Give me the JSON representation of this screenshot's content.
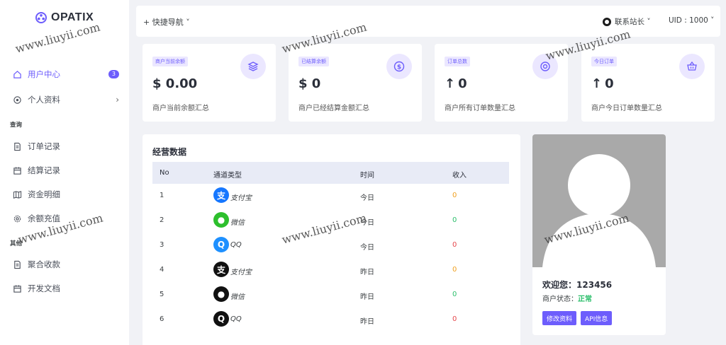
{
  "brand": {
    "name": "OPATIX"
  },
  "sidebar": {
    "items": [
      {
        "label": "用户中心",
        "badge": "3",
        "icon": "home-icon",
        "active": true
      },
      {
        "label": "个人资料",
        "icon": "user-settings-icon",
        "chevron": "›"
      }
    ],
    "sections": [
      {
        "title": "查询",
        "items": [
          {
            "label": "订单记录",
            "icon": "document-icon"
          },
          {
            "label": "结算记录",
            "icon": "calendar-icon"
          },
          {
            "label": "资金明细",
            "icon": "map-icon"
          },
          {
            "label": "余额充值",
            "icon": "cog-icon"
          }
        ]
      },
      {
        "title": "其他",
        "items": [
          {
            "label": "聚合收款",
            "icon": "document-icon"
          },
          {
            "label": "开发文档",
            "icon": "calendar-icon"
          }
        ]
      }
    ]
  },
  "topbar": {
    "quicknav_label": "+ 快捷导航 ˅",
    "contact_label": "联系站长 ˅",
    "uid_label": "UID : 1000 ˅"
  },
  "stats": [
    {
      "tag": "商户当前余额",
      "value": "$ 0.00",
      "desc": "商户当前余额汇总",
      "icon": "layers-icon"
    },
    {
      "tag": "已结算余额",
      "value": "$ 0",
      "desc": "商户已经结算金额汇总",
      "icon": "dollar-circle-icon"
    },
    {
      "tag": "订单总数",
      "value": "0",
      "desc": "商户所有订单数量汇总",
      "icon": "target-icon",
      "arrow": "↑"
    },
    {
      "tag": "今日订单",
      "value": "0",
      "desc": "商户今日订单数量汇总",
      "icon": "basket-icon",
      "arrow": "↑"
    }
  ],
  "table": {
    "title": "经营数据",
    "headers": [
      "No",
      "通道类型",
      "时间",
      "收入"
    ],
    "rows": [
      {
        "no": "1",
        "channel": "支付宝",
        "channel_icon": "alipay-icon",
        "glyph": "支",
        "time": "今日",
        "income": "0",
        "icon_color": "#1677ff",
        "income_color": "orange"
      },
      {
        "no": "2",
        "channel": "微信",
        "channel_icon": "wechat-icon",
        "glyph": "●",
        "time": "今日",
        "income": "0",
        "icon_color": "#2dbf2d",
        "income_color": "green"
      },
      {
        "no": "3",
        "channel": "QQ",
        "channel_icon": "qq-icon",
        "glyph": "Q",
        "time": "今日",
        "income": "0",
        "icon_color": "#1e90ff",
        "income_color": "red"
      },
      {
        "no": "4",
        "channel": "支付宝",
        "channel_icon": "alipay-icon",
        "glyph": "支",
        "time": "昨日",
        "income": "0",
        "icon_color": "#111111",
        "income_color": "orange"
      },
      {
        "no": "5",
        "channel": "微信",
        "channel_icon": "wechat-icon",
        "glyph": "●",
        "time": "昨日",
        "income": "0",
        "icon_color": "#111111",
        "income_color": "green"
      },
      {
        "no": "6",
        "channel": "QQ",
        "channel_icon": "qq-icon",
        "glyph": "Q",
        "time": "昨日",
        "income": "0",
        "icon_color": "#111111",
        "income_color": "red"
      }
    ]
  },
  "profile": {
    "welcome_prefix": "欢迎您：",
    "username": "123456",
    "status_label": "商户状态：",
    "status_value": "正常",
    "buttons": [
      "修改资料",
      "API信息"
    ]
  },
  "watermark": "www.liuyii.com",
  "colors": {
    "accent": "#6d5dfc",
    "accent_light": "#ebe7ff",
    "green": "#2dbf6c",
    "orange": "#f0a020",
    "red": "#e5484d"
  }
}
